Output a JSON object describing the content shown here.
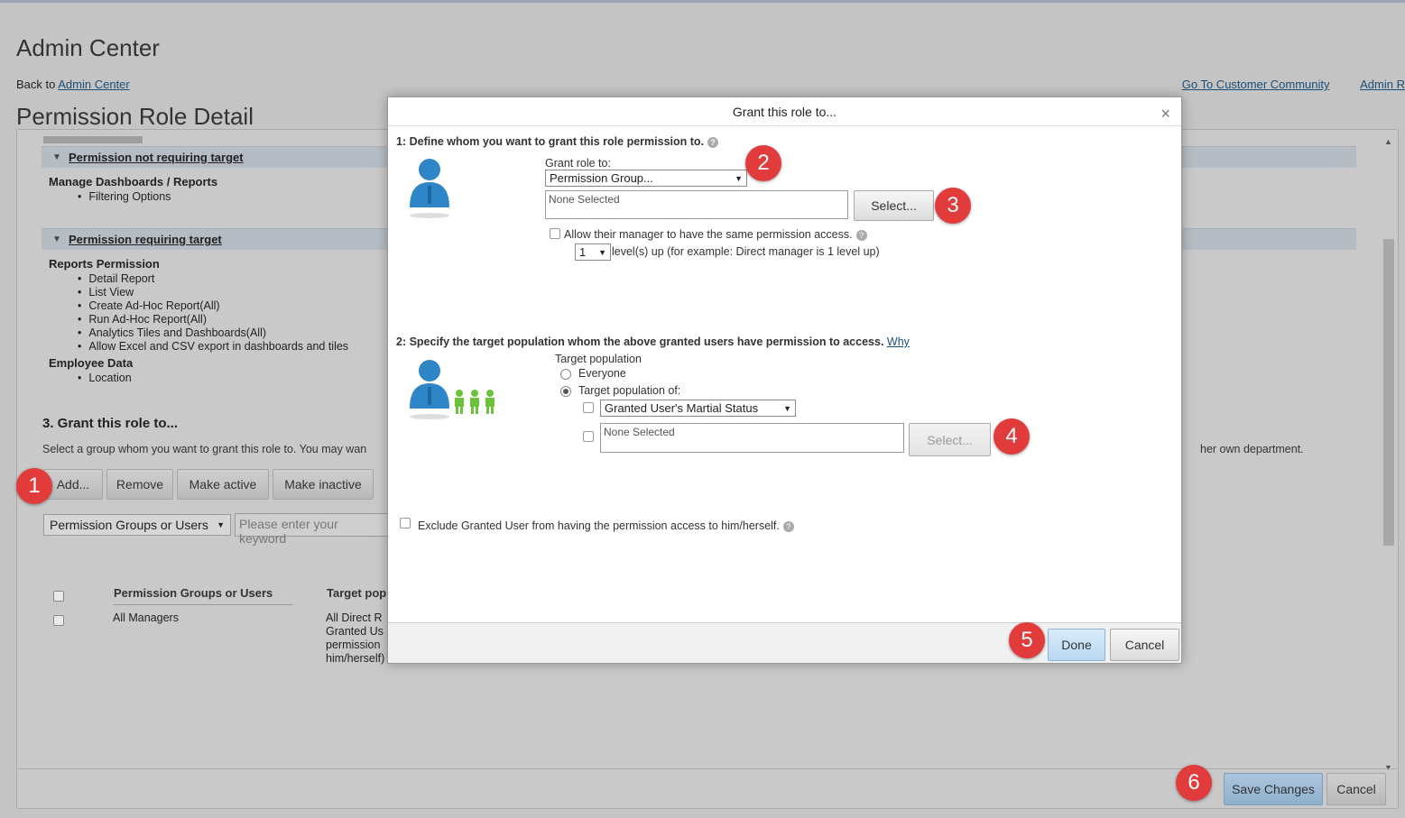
{
  "header": {
    "title": "Admin Center",
    "back_prefix": "Back to",
    "back_link": "Admin Center",
    "page_title": "Permission Role Detail"
  },
  "toplinks": [
    "Go To Customer Community",
    "Admin R"
  ],
  "sections": {
    "not_requiring": {
      "title": "Permission not requiring target"
    },
    "requiring": {
      "title": "Permission requiring target"
    }
  },
  "perm_not_req": {
    "group": "Manage Dashboards / Reports",
    "items": [
      "Filtering Options"
    ]
  },
  "perm_req": {
    "reports_group": "Reports Permission",
    "reports_items": [
      "Detail Report",
      "List View",
      "Create Ad-Hoc Report(All)",
      "Run Ad-Hoc Report(All)",
      "Analytics Tiles and Dashboards(All)",
      "Allow Excel and CSV export in dashboards and tiles"
    ],
    "employee_group": "Employee Data",
    "employee_items": [
      "Location"
    ]
  },
  "grant": {
    "heading": "3. Grant this role to...",
    "desc_left": "Select a group whom you want to grant this role to. You may wan",
    "desc_right": "her own department.",
    "buttons": {
      "add": "Add...",
      "remove": "Remove",
      "make_active": "Make active",
      "make_inactive": "Make inactive"
    },
    "filter_select": "Permission Groups or Users",
    "search_placeholder": "Please enter your keyword",
    "table": {
      "col1": "Permission Groups or Users",
      "col2": "Target pop",
      "row1_name": "All Managers",
      "row1_target": [
        "All Direct R",
        "Granted Us",
        "permission",
        "him/herself)"
      ]
    }
  },
  "footer": {
    "save": "Save Changes",
    "cancel": "Cancel"
  },
  "modal": {
    "title": "Grant this role to...",
    "close": "×",
    "step1": "1: Define whom you want to grant this role permission to.",
    "grant_role_label": "Grant role to:",
    "grant_role_value": "Permission Group...",
    "none_selected": "None Selected",
    "select_button": "Select...",
    "allow_manager": "Allow their manager to have the same permission access.",
    "levels_value": "1",
    "levels_text": "level(s) up (for example: Direct manager is 1 level up)",
    "step2": "2: Specify the target population whom the above granted users have permission to access.",
    "why": "Why",
    "target_label": "Target population",
    "everyone": "Everyone",
    "target_of": "Target population of:",
    "target_select": "Granted User's Martial Status",
    "target_none": "None Selected",
    "target_select_btn": "Select...",
    "exclude": "Exclude Granted User from having the permission access to him/herself.",
    "done": "Done",
    "cancel": "Cancel"
  },
  "badges": [
    "1",
    "2",
    "3",
    "4",
    "5",
    "6"
  ],
  "colors": {
    "badge": "#e13b3b",
    "link": "#1a4f7a",
    "section_bar": "#b5bcc4",
    "done_button": "#b8d8f2"
  }
}
